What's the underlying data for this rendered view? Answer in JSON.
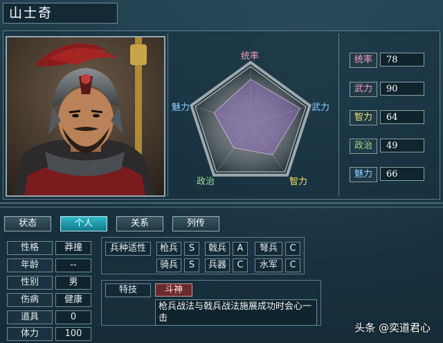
{
  "officer_name": "山士奇",
  "radar": {
    "labels": {
      "tong": "统率",
      "wu": "武力",
      "zhi": "智力",
      "zheng": "政治",
      "mei": "魅力"
    },
    "label_colors": {
      "tong": "#ff9dc0",
      "wu": "#8fd0ff",
      "zhi": "#f2e36b",
      "zheng": "#9be28f",
      "mei": "#8fd0ff"
    },
    "values": {
      "tong": 78,
      "wu": 90,
      "zhi": 64,
      "zheng": 49,
      "mei": 66
    },
    "max": 100
  },
  "stats": [
    {
      "label": "统率",
      "value": "78",
      "color": "#ff9dc0"
    },
    {
      "label": "武力",
      "value": "90",
      "color": "#ff9dc0"
    },
    {
      "label": "智力",
      "value": "64",
      "color": "#f2e36b"
    },
    {
      "label": "政治",
      "value": "49",
      "color": "#9be28f"
    },
    {
      "label": "魅力",
      "value": "66",
      "color": "#8fd0ff"
    }
  ],
  "tabs": [
    "状态",
    "个人",
    "关系",
    "列传"
  ],
  "active_tab": "个人",
  "info": [
    {
      "label": "性格",
      "value": "莽撞"
    },
    {
      "label": "年龄",
      "value": "--"
    },
    {
      "label": "性别",
      "value": "男"
    },
    {
      "label": "伤病",
      "value": "健康"
    },
    {
      "label": "道具",
      "value": "0"
    },
    {
      "label": "体力",
      "value": "100"
    }
  ],
  "aptitude": {
    "header": "兵种适性",
    "units": [
      {
        "name": "枪兵",
        "grade": "S"
      },
      {
        "name": "戟兵",
        "grade": "A"
      },
      {
        "name": "弩兵",
        "grade": "C"
      },
      {
        "name": "骑兵",
        "grade": "S"
      },
      {
        "name": "兵器",
        "grade": "C"
      },
      {
        "name": "水军",
        "grade": "C"
      }
    ]
  },
  "special": {
    "header": "特技",
    "name": "斗神",
    "description": "枪兵战法与戟兵战法施展成功时会心一击"
  },
  "watermark": "头条 @奕道君心"
}
